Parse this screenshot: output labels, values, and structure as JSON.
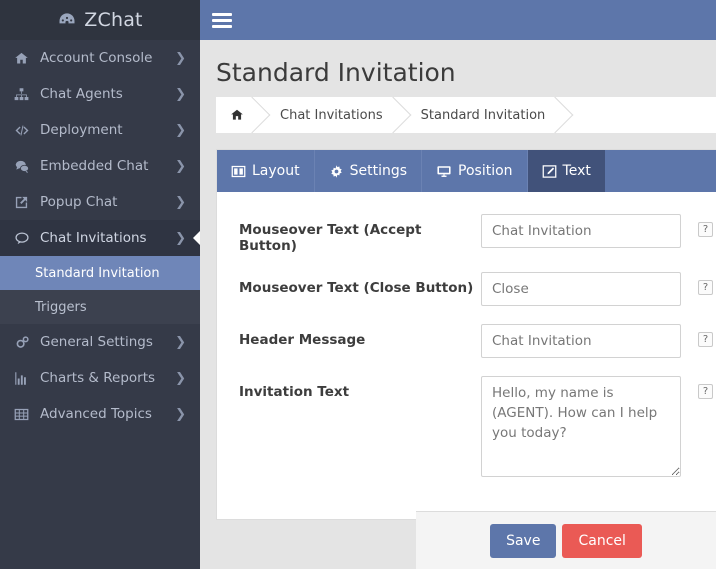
{
  "brand": {
    "name": "ZChat",
    "logo_icon": "dashboard-gauge-icon"
  },
  "sidebar": {
    "items": [
      {
        "label": "Account Console",
        "icon": "home-icon",
        "chevron": "❯",
        "expanded": false
      },
      {
        "label": "Chat Agents",
        "icon": "sitemap-icon",
        "chevron": "❯",
        "expanded": false
      },
      {
        "label": "Deployment",
        "icon": "code-icon",
        "chevron": "❯",
        "expanded": false
      },
      {
        "label": "Embedded Chat",
        "icon": "comments-icon",
        "chevron": "❯",
        "expanded": false
      },
      {
        "label": "Popup Chat",
        "icon": "external-link-icon",
        "chevron": "❯",
        "expanded": false
      },
      {
        "label": "Chat Invitations",
        "icon": "comment-icon",
        "chevron": "❯",
        "expanded": true
      },
      {
        "label": "General Settings",
        "icon": "cogs-icon",
        "chevron": "❯",
        "expanded": false
      },
      {
        "label": "Charts & Reports",
        "icon": "bar-chart-icon",
        "chevron": "❯",
        "expanded": false
      },
      {
        "label": "Advanced Topics",
        "icon": "table-icon",
        "chevron": "❯",
        "expanded": false
      }
    ],
    "submenu": [
      {
        "label": "Standard Invitation",
        "active": true
      },
      {
        "label": "Triggers",
        "active": false
      }
    ]
  },
  "topbar": {
    "menu_toggle_icon": "hamburger-icon"
  },
  "page": {
    "title": "Standard Invitation"
  },
  "breadcrumb": {
    "home_icon": "home-icon",
    "items": [
      {
        "label": "Chat Invitations"
      },
      {
        "label": "Standard Invitation"
      }
    ]
  },
  "tabs": [
    {
      "label": "Layout",
      "icon": "columns-icon",
      "active": false
    },
    {
      "label": "Settings",
      "icon": "gear-icon",
      "active": false
    },
    {
      "label": "Position",
      "icon": "desktop-icon",
      "active": false
    },
    {
      "label": "Text",
      "icon": "pencil-square-icon",
      "active": true
    }
  ],
  "form": {
    "help_label": "?",
    "fields": [
      {
        "label": "Mouseover Text (Accept Button)",
        "value": "Chat Invitation",
        "placeholder": "Chat Invitation",
        "type": "text"
      },
      {
        "label": "Mouseover Text (Close Button)",
        "value": "Close",
        "placeholder": "Close",
        "type": "text"
      },
      {
        "label": "Header Message",
        "value": "Chat Invitation",
        "placeholder": "Chat Invitation",
        "type": "text"
      },
      {
        "label": "Invitation Text",
        "value": "Hello, my name is (AGENT). How can I help you today?",
        "placeholder": "Hello, my name is (AGENT). How can I help you today?",
        "type": "textarea"
      }
    ]
  },
  "footer": {
    "save_label": "Save",
    "cancel_label": "Cancel"
  },
  "colors": {
    "brand_bg": "#2f343f",
    "sidebar_bg": "#353a48",
    "submenu_bg": "#3c414f",
    "accent_blue": "#5d76aa",
    "active_blue": "#6f86b8",
    "tab_active": "#41527a",
    "danger_red": "#ea5a55",
    "page_bg": "#e4e4e4"
  }
}
